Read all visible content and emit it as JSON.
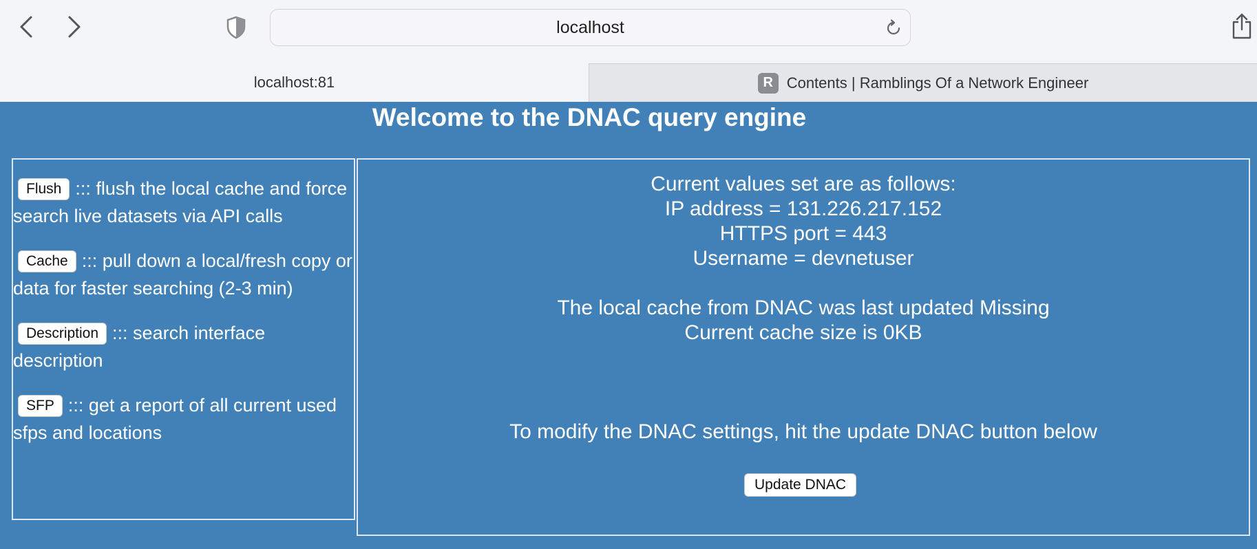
{
  "browser": {
    "url": "localhost",
    "tabs": [
      {
        "label": "localhost:81"
      },
      {
        "label": "Contents | Ramblings Of a Network Engineer",
        "favicon": "R"
      }
    ]
  },
  "page": {
    "title": "Welcome to the DNAC query engine",
    "commands": [
      {
        "button": "Flush",
        "text": "::: flush the local cache and force search live datasets via API calls"
      },
      {
        "button": "Cache",
        "text": "::: pull down a local/fresh copy or data for faster searching (2-3 min)"
      },
      {
        "button": "Description",
        "text": "::: search interface description"
      },
      {
        "button": "SFP",
        "text": "::: get a report of all current used sfps and locations"
      }
    ],
    "settings": {
      "heading": "Current values set are as follows:",
      "ip": "IP address = 131.226.217.152",
      "port": "HTTPS port = 443",
      "username": "Username = devnetuser",
      "cache_updated": "The local cache from DNAC was last updated Missing",
      "cache_size": "Current cache size is 0KB",
      "modify_hint": "To modify the DNAC settings, hit the update DNAC button below",
      "update_button": "Update DNAC"
    }
  }
}
